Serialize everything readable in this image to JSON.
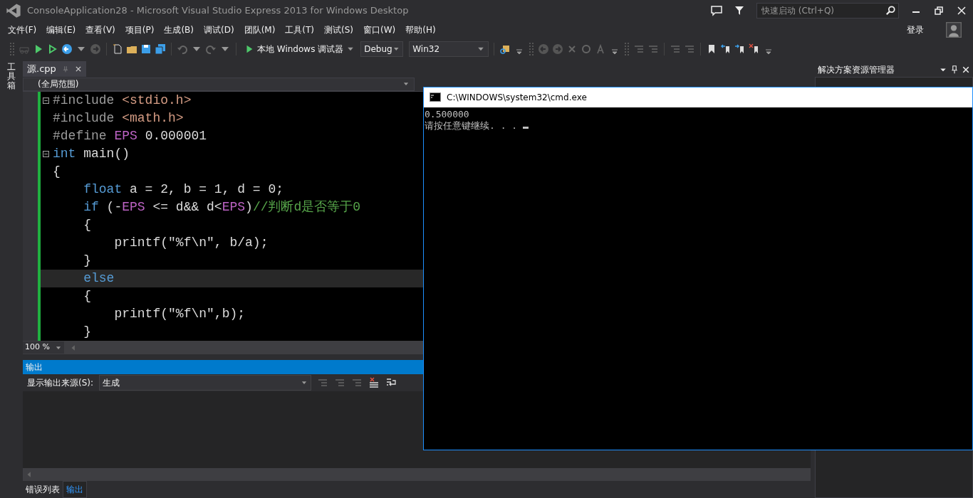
{
  "window": {
    "title": "ConsoleApplication28 - Microsoft Visual Studio Express 2013 for Windows Desktop",
    "quick_launch": {
      "placeholder": "快速启动 (Ctrl+Q)"
    },
    "sign_in": "登录"
  },
  "menu": [
    "文件(F)",
    "编辑(E)",
    "查看(V)",
    "项目(P)",
    "生成(B)",
    "调试(D)",
    "团队(M)",
    "工具(T)",
    "测试(S)",
    "窗口(W)",
    "帮助(H)"
  ],
  "toolbar": {
    "debugger": "本地 Windows 调试器",
    "configuration": "Debug",
    "platform": "Win32"
  },
  "toolbox_tab": "工具箱",
  "editor": {
    "tabs": [
      {
        "label": "源.cpp",
        "selected": true
      }
    ],
    "scope": "(全局范围)",
    "zoom": "100 %",
    "lines": [
      {
        "foldable": true,
        "current": false,
        "tokens": [
          {
            "kind": "preproc",
            "text": "#include "
          },
          {
            "kind": "string",
            "text": "<stdio.h>"
          }
        ]
      },
      {
        "foldable": false,
        "current": false,
        "tokens": [
          {
            "kind": "preproc",
            "text": "#include "
          },
          {
            "kind": "string",
            "text": "<math.h>"
          }
        ]
      },
      {
        "foldable": false,
        "current": false,
        "tokens": [
          {
            "kind": "preproc",
            "text": "#define "
          },
          {
            "kind": "macro",
            "text": "EPS"
          },
          {
            "kind": "plain",
            "text": " 0.000001"
          }
        ]
      },
      {
        "foldable": true,
        "current": false,
        "tokens": [
          {
            "kind": "keyword",
            "text": "int"
          },
          {
            "kind": "plain",
            "text": " main()"
          }
        ]
      },
      {
        "foldable": false,
        "current": false,
        "tokens": [
          {
            "kind": "plain",
            "text": "{"
          }
        ]
      },
      {
        "foldable": false,
        "current": false,
        "tokens": [
          {
            "kind": "keyword",
            "text": "    float"
          },
          {
            "kind": "plain",
            "text": " a = 2, b = 1, d = 0;"
          }
        ]
      },
      {
        "foldable": false,
        "current": false,
        "tokens": [
          {
            "kind": "keyword",
            "text": "    if"
          },
          {
            "kind": "plain",
            "text": " (-"
          },
          {
            "kind": "macro",
            "text": "EPS"
          },
          {
            "kind": "plain",
            "text": " <= d&& d<"
          },
          {
            "kind": "macro",
            "text": "EPS"
          },
          {
            "kind": "plain",
            "text": ")"
          },
          {
            "kind": "comment",
            "text": "//判断d是否等于0"
          }
        ]
      },
      {
        "foldable": false,
        "current": false,
        "tokens": [
          {
            "kind": "plain",
            "text": "    {"
          }
        ]
      },
      {
        "foldable": false,
        "current": false,
        "tokens": [
          {
            "kind": "plain",
            "text": "        printf(\"%f\\n\", b/a);"
          }
        ]
      },
      {
        "foldable": false,
        "current": false,
        "tokens": [
          {
            "kind": "plain",
            "text": "    }"
          }
        ]
      },
      {
        "foldable": false,
        "current": true,
        "tokens": [
          {
            "kind": "keyword",
            "text": "    else"
          }
        ]
      },
      {
        "foldable": false,
        "current": false,
        "tokens": [
          {
            "kind": "plain",
            "text": "    {"
          }
        ]
      },
      {
        "foldable": false,
        "current": false,
        "tokens": [
          {
            "kind": "plain",
            "text": "        printf(\"%f\\n\",b);"
          }
        ]
      },
      {
        "foldable": false,
        "current": false,
        "tokens": [
          {
            "kind": "plain",
            "text": "    }"
          }
        ]
      }
    ]
  },
  "solution_explorer": {
    "title": "解决方案资源管理器"
  },
  "output": {
    "title": "输出",
    "source_label": "显示输出来源(S):",
    "source": "生成"
  },
  "bottom_tabs": [
    {
      "label": "错误列表",
      "selected": false
    },
    {
      "label": "输出",
      "selected": true
    }
  ],
  "console": {
    "title": "C:\\WINDOWS\\system32\\cmd.exe",
    "lines": [
      "0.500000",
      "请按任意键继续. . . "
    ]
  }
}
